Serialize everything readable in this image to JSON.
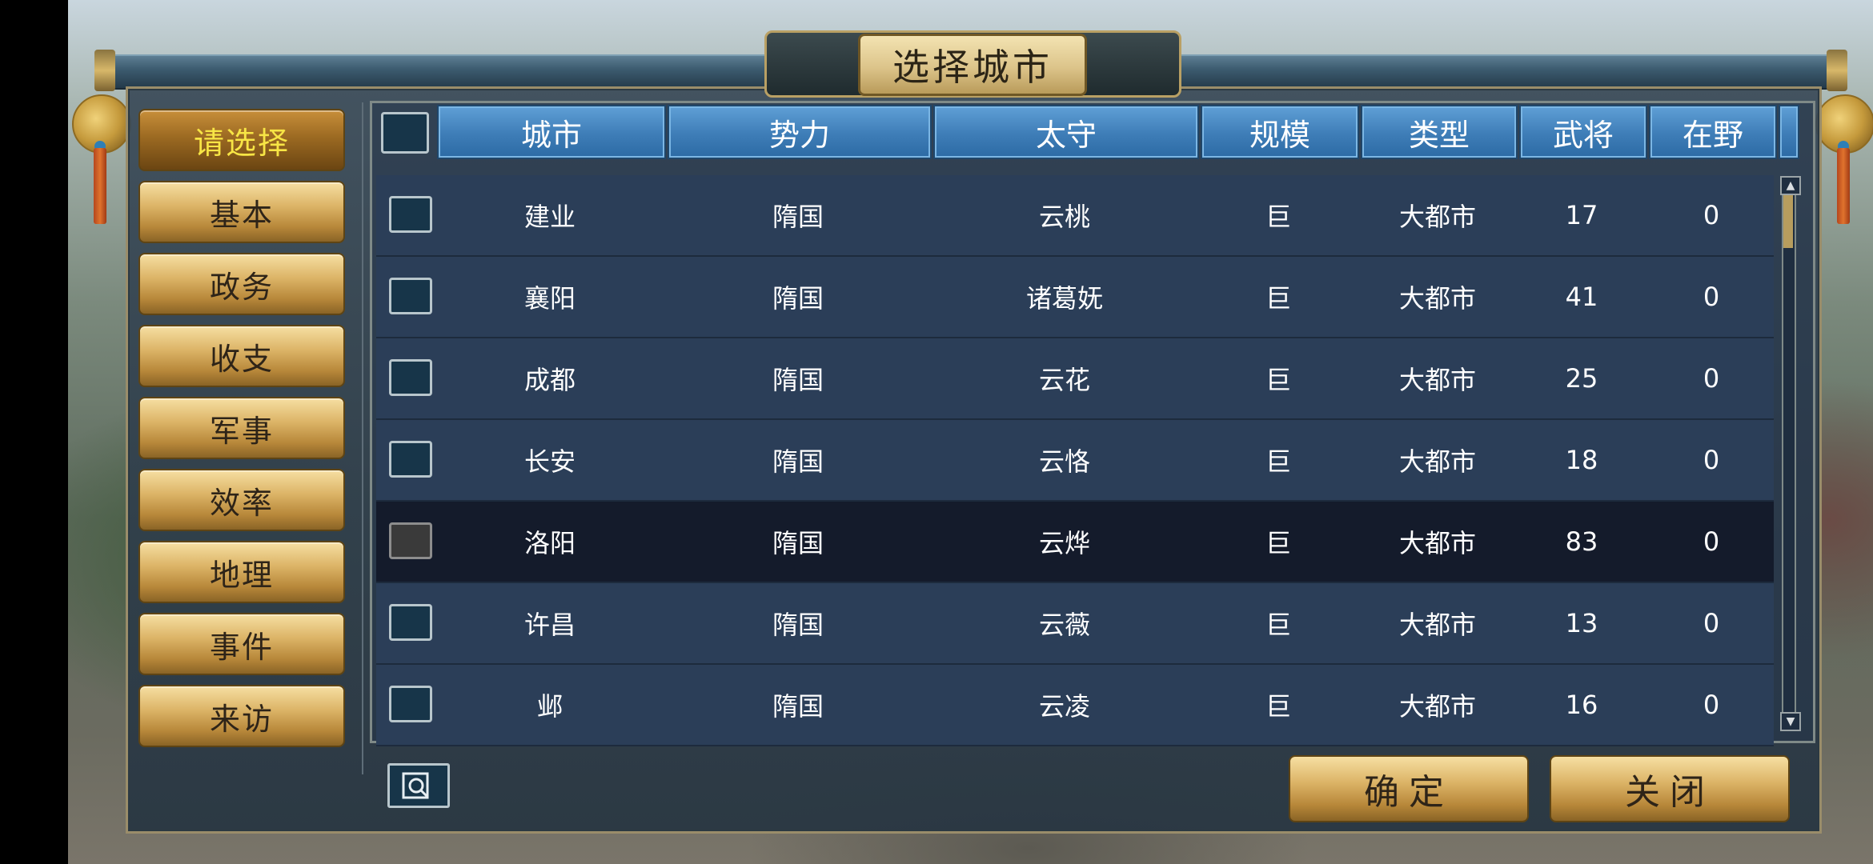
{
  "title": "选择城市",
  "menu": {
    "items": [
      {
        "label": "请选择",
        "active": true
      },
      {
        "label": "基本"
      },
      {
        "label": "政务"
      },
      {
        "label": "收支"
      },
      {
        "label": "军事"
      },
      {
        "label": "效率"
      },
      {
        "label": "地理"
      },
      {
        "label": "事件"
      },
      {
        "label": "来访"
      }
    ]
  },
  "table": {
    "columns": [
      "城市",
      "势力",
      "太守",
      "规模",
      "类型",
      "武将",
      "在野"
    ],
    "rows": [
      {
        "city": "建业",
        "faction": "隋国",
        "governor": "云桃",
        "scale": "巨",
        "type": "大都市",
        "generals": "17",
        "wild": "0"
      },
      {
        "city": "襄阳",
        "faction": "隋国",
        "governor": "诸葛妩",
        "scale": "巨",
        "type": "大都市",
        "generals": "41",
        "wild": "0"
      },
      {
        "city": "成都",
        "faction": "隋国",
        "governor": "云花",
        "scale": "巨",
        "type": "大都市",
        "generals": "25",
        "wild": "0"
      },
      {
        "city": "长安",
        "faction": "隋国",
        "governor": "云恪",
        "scale": "巨",
        "type": "大都市",
        "generals": "18",
        "wild": "0"
      },
      {
        "city": "洛阳",
        "faction": "隋国",
        "governor": "云烨",
        "scale": "巨",
        "type": "大都市",
        "generals": "83",
        "wild": "0",
        "selected": true
      },
      {
        "city": "许昌",
        "faction": "隋国",
        "governor": "云薇",
        "scale": "巨",
        "type": "大都市",
        "generals": "13",
        "wild": "0"
      },
      {
        "city": "邺",
        "faction": "隋国",
        "governor": "云凌",
        "scale": "巨",
        "type": "大都市",
        "generals": "16",
        "wild": "0"
      }
    ]
  },
  "buttons": {
    "confirm": "确定",
    "close": "关闭"
  },
  "icons": {
    "search": "search-icon",
    "scroll_up": "scroll-up-icon",
    "scroll_down": "scroll-down-icon"
  },
  "colors": {
    "header_blue": "#3e7db7",
    "row_bg": "#2b3e58",
    "selected_row_bg": "#141b2b",
    "active_menu_text": "#f7e545",
    "gold_button": "#dcb467"
  }
}
